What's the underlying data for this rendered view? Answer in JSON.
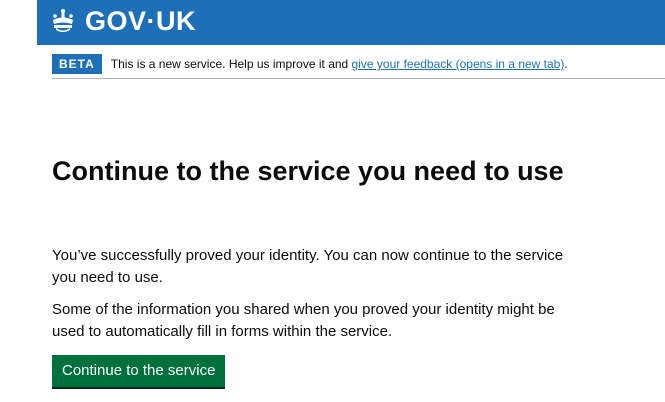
{
  "header": {
    "logo_text": "GOV·UK",
    "logo_icon": "crown-icon"
  },
  "phase_banner": {
    "tag": "BETA",
    "text": "This is a new service. Help us improve it and ",
    "link_text": "give your feedback (opens in a new tab)",
    "suffix": "."
  },
  "main": {
    "heading": "Continue to the service you need to use",
    "paragraph_1": "You’ve successfully proved your identity. You can now continue to the service you need to use.",
    "paragraph_2": "Some of the information you shared when you proved your identity might be used to automatically fill in forms within the service.",
    "button_label": "Continue to the service"
  },
  "colors": {
    "brand_blue": "#1d70b8",
    "button_green": "#00703c",
    "link_blue": "#1d70b8",
    "text": "#0b0c0c"
  }
}
